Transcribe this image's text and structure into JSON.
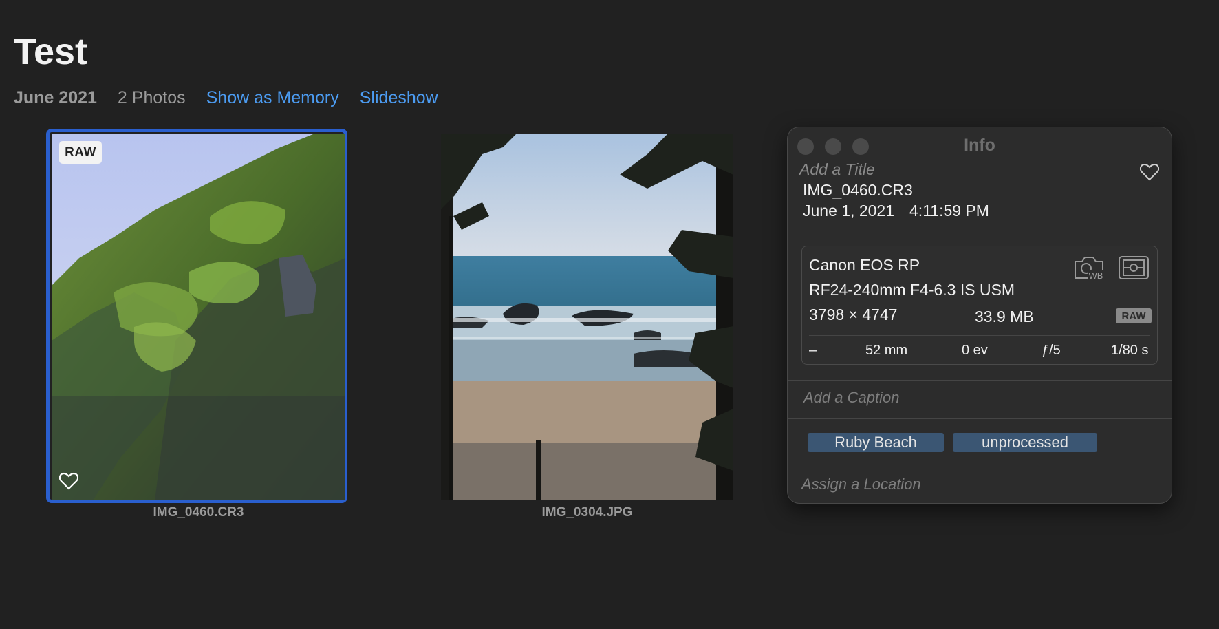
{
  "header": {
    "album_title": "Test",
    "date": "June 2021",
    "photo_count": "2 Photos",
    "show_as_memory": "Show as Memory",
    "slideshow": "Slideshow"
  },
  "photos": [
    {
      "filename": "IMG_0460.CR3",
      "badge": "RAW",
      "selected": true,
      "favorite_icon": "heart-outline-icon"
    },
    {
      "filename": "IMG_0304.JPG",
      "selected": false
    }
  ],
  "info_panel": {
    "title": "Info",
    "add_title_placeholder": "Add a Title",
    "filename": "IMG_0460.CR3",
    "date": "June 1, 2021",
    "time": "4:11:59 PM",
    "camera": {
      "model": "Canon EOS RP",
      "lens": "RF24-240mm F4-6.3 IS USM",
      "dimensions": "3798 × 4747",
      "file_size": "33.9 MB",
      "format_badge": "RAW",
      "iso": "–",
      "focal_length": "52 mm",
      "exposure_bias": "0 ev",
      "aperture": "ƒ/5",
      "shutter": "1/80 s",
      "wb_icon_label": "WB"
    },
    "add_caption_placeholder": "Add a Caption",
    "keywords": [
      "Ruby Beach",
      "unprocessed"
    ],
    "assign_location_placeholder": "Assign a Location"
  },
  "colors": {
    "background": "#212121",
    "accent_link": "#4c9cf2",
    "selection_border": "#2a5fce",
    "keyword_bg": "#3b5673"
  }
}
